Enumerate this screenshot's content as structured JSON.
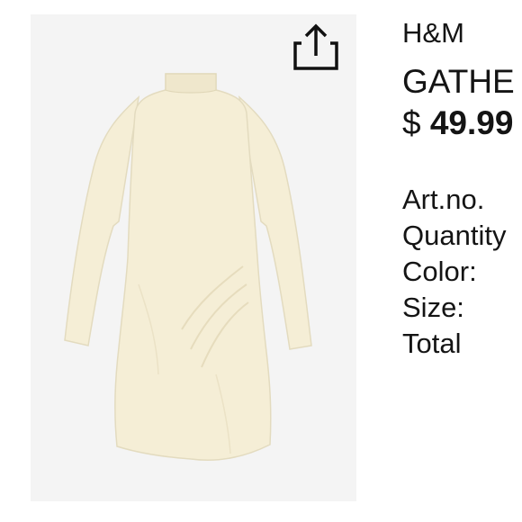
{
  "product": {
    "brand": "H&M",
    "title": "GATHE",
    "price_currency": "$",
    "price_amount": "49.99",
    "image_icon": "dress-image",
    "garment_color": "#f5eed6"
  },
  "actions": {
    "share_icon": "share-icon"
  },
  "details": {
    "art_no_label": "Art.no.",
    "quantity_label": "Quantity",
    "color_label": "Color:",
    "size_label": "Size:",
    "total_label": "Total"
  }
}
